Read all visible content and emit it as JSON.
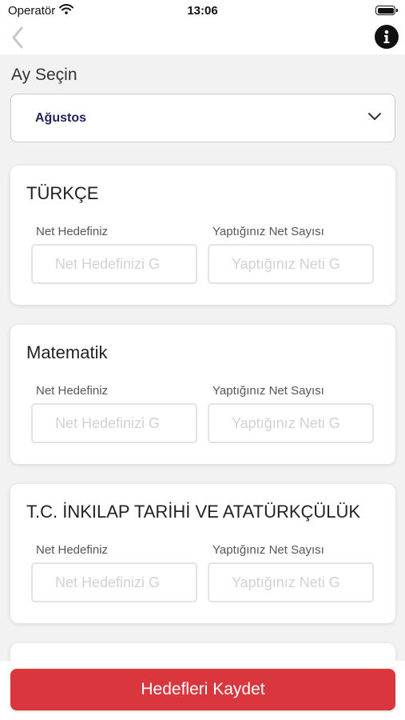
{
  "status": {
    "carrier": "Operatör",
    "time": "13:06"
  },
  "month": {
    "label": "Ay Seçin",
    "selected": "Ağustos"
  },
  "fields": {
    "target_label": "Net Hedefiniz",
    "done_label": "Yaptığınız Net Sayısı",
    "target_placeholder": "Net Hedefinizi G",
    "done_placeholder": "Yaptığınız Neti G"
  },
  "subjects": [
    {
      "title": "TÜRKÇE",
      "target": "",
      "done": ""
    },
    {
      "title": "Matematik",
      "target": "",
      "done": ""
    },
    {
      "title": "T.C. İNKILAP TARİHİ VE ATATÜRKÇÜLÜK",
      "target": "",
      "done": ""
    }
  ],
  "save_button": {
    "label": "Hedefleri Kaydet"
  },
  "colors": {
    "accent": "#d9363e",
    "month_text": "#23245a"
  }
}
